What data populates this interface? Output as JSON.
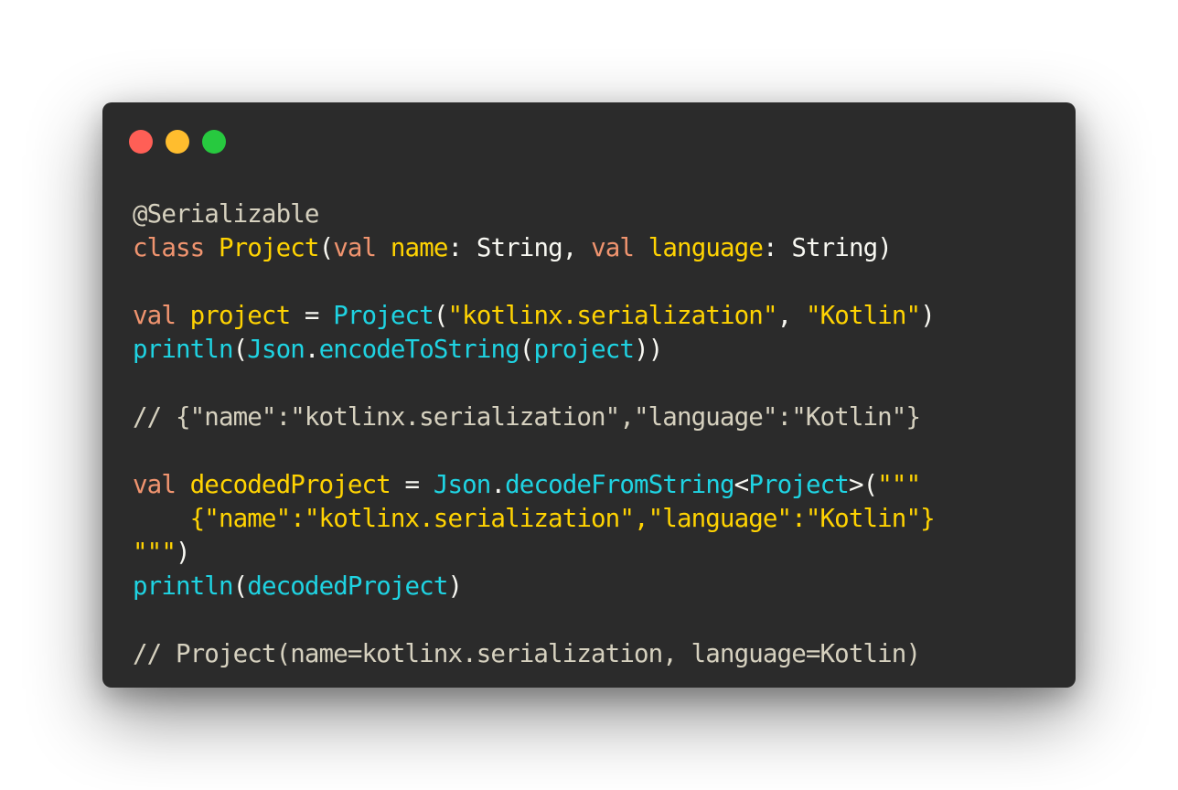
{
  "window": {
    "traffic_lights": [
      {
        "name": "close",
        "color": "#ff5f56"
      },
      {
        "name": "minimize",
        "color": "#ffbd2e"
      },
      {
        "name": "zoom",
        "color": "#27c93f"
      }
    ]
  },
  "code_lines": [
    [
      {
        "t": "annotation",
        "v": "@Serializable"
      }
    ],
    [
      {
        "t": "keyword",
        "v": "class "
      },
      {
        "t": "class",
        "v": "Project"
      },
      {
        "t": "plain",
        "v": "("
      },
      {
        "t": "keyword",
        "v": "val "
      },
      {
        "t": "param",
        "v": "name"
      },
      {
        "t": "plain",
        "v": ": String, "
      },
      {
        "t": "keyword",
        "v": "val "
      },
      {
        "t": "param",
        "v": "language"
      },
      {
        "t": "plain",
        "v": ": String)"
      }
    ],
    [],
    [
      {
        "t": "keyword",
        "v": "val "
      },
      {
        "t": "param",
        "v": "project"
      },
      {
        "t": "plain",
        "v": " = "
      },
      {
        "t": "func",
        "v": "Project"
      },
      {
        "t": "plain",
        "v": "("
      },
      {
        "t": "string",
        "v": "\"kotlinx.serialization\""
      },
      {
        "t": "plain",
        "v": ", "
      },
      {
        "t": "string",
        "v": "\"Kotlin\""
      },
      {
        "t": "plain",
        "v": ")"
      }
    ],
    [
      {
        "t": "func",
        "v": "println"
      },
      {
        "t": "plain",
        "v": "("
      },
      {
        "t": "func",
        "v": "Json"
      },
      {
        "t": "plain",
        "v": "."
      },
      {
        "t": "func",
        "v": "encodeToString"
      },
      {
        "t": "plain",
        "v": "("
      },
      {
        "t": "func",
        "v": "project"
      },
      {
        "t": "plain",
        "v": "))"
      }
    ],
    [],
    [
      {
        "t": "comment",
        "v": "// {\"name\":\"kotlinx.serialization\",\"language\":\"Kotlin\"}"
      }
    ],
    [],
    [
      {
        "t": "keyword",
        "v": "val "
      },
      {
        "t": "param",
        "v": "decodedProject"
      },
      {
        "t": "plain",
        "v": " = "
      },
      {
        "t": "func",
        "v": "Json"
      },
      {
        "t": "plain",
        "v": "."
      },
      {
        "t": "func",
        "v": "decodeFromString"
      },
      {
        "t": "plain",
        "v": "<"
      },
      {
        "t": "func",
        "v": "Project"
      },
      {
        "t": "plain",
        "v": ">("
      },
      {
        "t": "string",
        "v": "\"\"\""
      }
    ],
    [
      {
        "t": "string",
        "v": "    {\"name\":\"kotlinx.serialization\",\"language\":\"Kotlin\"}"
      }
    ],
    [
      {
        "t": "string",
        "v": "\"\"\""
      },
      {
        "t": "plain",
        "v": ")"
      }
    ],
    [
      {
        "t": "func",
        "v": "println"
      },
      {
        "t": "plain",
        "v": "("
      },
      {
        "t": "func",
        "v": "decodedProject"
      },
      {
        "t": "plain",
        "v": ")"
      }
    ],
    [],
    [
      {
        "t": "comment",
        "v": "// Project(name=kotlinx.serialization, language=Kotlin)"
      }
    ]
  ]
}
